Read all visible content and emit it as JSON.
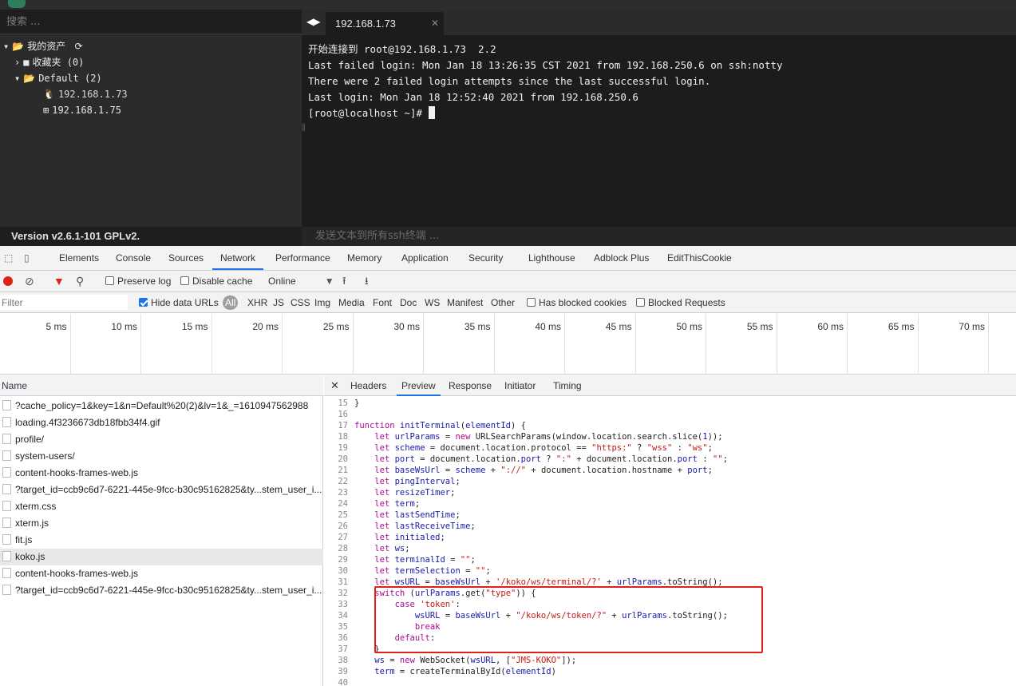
{
  "app": {
    "search_placeholder": "搜索 ...",
    "tree": {
      "root_label": "我的资产",
      "favorites_label": "收藏夹 (0)",
      "default_label": "Default (2)",
      "hosts": [
        "192.168.1.73",
        "192.168.1.75"
      ]
    },
    "version": "Version v2.6.1-101 GPLv2.",
    "terminal": {
      "tab_title": "192.168.1.73",
      "lines": [
        "开始连接到 root@192.168.1.73  2.2",
        "Last failed login: Mon Jan 18 13:26:35 CST 2021 from 192.168.250.6 on ssh:notty",
        "There were 2 failed login attempts since the last successful login.",
        "Last login: Mon Jan 18 12:52:40 2021 from 192.168.250.6"
      ],
      "prompt": "[root@localhost ~]#",
      "send_placeholder": "发送文本到所有ssh终端 ..."
    }
  },
  "devtools": {
    "tabs": [
      "Elements",
      "Console",
      "Sources",
      "Network",
      "Performance",
      "Memory",
      "Application",
      "Security",
      "Lighthouse",
      "Adblock Plus",
      "EditThisCookie"
    ],
    "active_tab": "Network",
    "toolbar": {
      "preserve_log": "Preserve log",
      "disable_cache": "Disable cache",
      "throttle": "Online"
    },
    "filter": {
      "placeholder": "Filter",
      "hide_data_urls": "Hide data URLs",
      "all": "All",
      "types": [
        "XHR",
        "JS",
        "CSS",
        "Img",
        "Media",
        "Font",
        "Doc",
        "WS",
        "Manifest",
        "Other"
      ],
      "blocked_cookies": "Has blocked cookies",
      "blocked_requests": "Blocked Requests"
    },
    "timeline_ticks": [
      "5 ms",
      "10 ms",
      "15 ms",
      "20 ms",
      "25 ms",
      "30 ms",
      "35 ms",
      "40 ms",
      "45 ms",
      "50 ms",
      "55 ms",
      "60 ms",
      "65 ms",
      "70 ms"
    ],
    "requests_header": "Name",
    "requests": [
      "?cache_policy=1&key=1&n=Default%20(2)&lv=1&_=1610947562988",
      "loading.4f3236673db18fbb34f4.gif",
      "profile/",
      "system-users/",
      "content-hooks-frames-web.js",
      "?target_id=ccb9c6d7-6221-445e-9fcc-b30c95162825&ty...stem_user_i...",
      "xterm.css",
      "xterm.js",
      "fit.js",
      "koko.js",
      "content-hooks-frames-web.js",
      "?target_id=ccb9c6d7-6221-445e-9fcc-b30c95162825&ty...stem_user_i..."
    ],
    "selected_request": "koko.js",
    "preview_tabs": [
      "Headers",
      "Preview",
      "Response",
      "Initiator",
      "Timing"
    ],
    "active_preview_tab": "Preview",
    "code_lines": [
      {
        "n": "15",
        "t": "}"
      },
      {
        "n": "16",
        "t": ""
      },
      {
        "n": "17",
        "t": "function initTerminal(elementId) {"
      },
      {
        "n": "18",
        "t": "    let urlParams = new URLSearchParams(window.location.search.slice(1));"
      },
      {
        "n": "19",
        "t": "    let scheme = document.location.protocol == \"https:\" ? \"wss\" : \"ws\";"
      },
      {
        "n": "20",
        "t": "    let port = document.location.port ? \":\" + document.location.port : \"\";"
      },
      {
        "n": "21",
        "t": "    let baseWsUrl = scheme + \"://\" + document.location.hostname + port;"
      },
      {
        "n": "22",
        "t": "    let pingInterval;"
      },
      {
        "n": "23",
        "t": "    let resizeTimer;"
      },
      {
        "n": "24",
        "t": "    let term;"
      },
      {
        "n": "25",
        "t": "    let lastSendTime;"
      },
      {
        "n": "26",
        "t": "    let lastReceiveTime;"
      },
      {
        "n": "27",
        "t": "    let initialed;"
      },
      {
        "n": "28",
        "t": "    let ws;"
      },
      {
        "n": "29",
        "t": "    let terminalId = \"\";"
      },
      {
        "n": "30",
        "t": "    let termSelection = \"\";"
      },
      {
        "n": "31",
        "t": "    let wsURL = baseWsUrl + '/koko/ws/terminal/?' + urlParams.toString();"
      },
      {
        "n": "32",
        "t": "    switch (urlParams.get(\"type\")) {"
      },
      {
        "n": "33",
        "t": "        case 'token':"
      },
      {
        "n": "34",
        "t": "            wsURL = baseWsUrl + \"/koko/ws/token/?\" + urlParams.toString();"
      },
      {
        "n": "35",
        "t": "            break"
      },
      {
        "n": "36",
        "t": "        default:"
      },
      {
        "n": "37",
        "t": "    }"
      },
      {
        "n": "38",
        "t": "    ws = new WebSocket(wsURL, [\"JMS-KOKO\"]);"
      },
      {
        "n": "39",
        "t": "    term = createTerminalById(elementId)"
      },
      {
        "n": "40",
        "t": ""
      }
    ]
  }
}
